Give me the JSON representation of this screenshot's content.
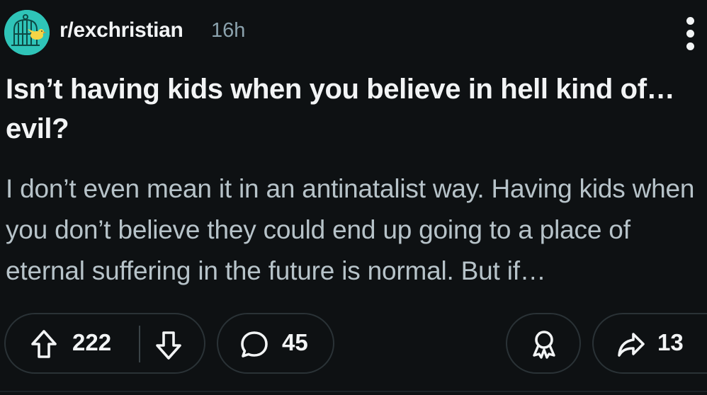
{
  "post": {
    "subreddit": "r/exchristian",
    "time": "16h",
    "title": "Isn’t having kids when you believe in hell kind of… evil?",
    "body_preview": "I don’t even mean it in an antinatalist way. Having kids when you don’t believe they could end up going to a place of eternal suffering in the future is normal. But if…"
  },
  "actions": {
    "upvotes": "222",
    "comments": "45",
    "shares": "13"
  },
  "icons": {
    "avatar": "birdcage-bird-icon",
    "more": "more-vertical-icon",
    "upvote": "upvote-arrow-icon",
    "downvote": "downvote-arrow-icon",
    "comment": "comment-bubble-icon",
    "award": "award-icon",
    "share": "share-arrow-icon"
  },
  "colors": {
    "background": "#0e1113",
    "primary_text": "#f2f4f5",
    "secondary_text": "#b7c3c9",
    "meta_text": "#8ba2ad",
    "avatar_bg": "#2fc4b8",
    "pill_border": "#2a3236"
  }
}
